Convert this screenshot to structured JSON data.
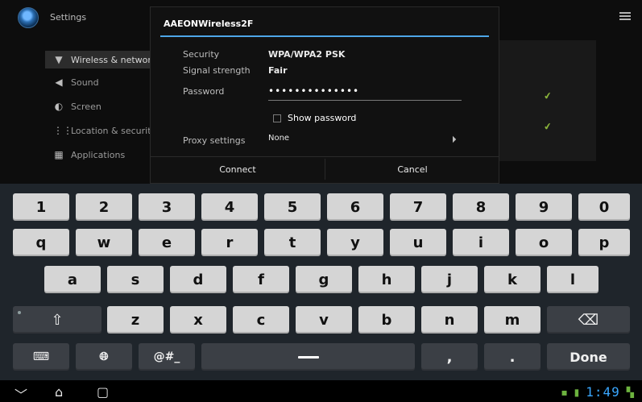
{
  "app": {
    "title": "Settings"
  },
  "settings_menu": {
    "items": [
      {
        "label": "Wireless & networks",
        "icon": "wifi-icon",
        "selected": true
      },
      {
        "label": "Sound",
        "icon": "speaker-icon",
        "selected": false
      },
      {
        "label": "Screen",
        "icon": "screen-icon",
        "selected": false
      },
      {
        "label": "Location & security",
        "icon": "grid-icon",
        "selected": false
      },
      {
        "label": "Applications",
        "icon": "apps-icon",
        "selected": false
      }
    ]
  },
  "dialog": {
    "title": "AAEONWireless2F",
    "security_label": "Security",
    "security_value": "WPA/WPA2 PSK",
    "signal_label": "Signal strength",
    "signal_value": "Fair",
    "password_label": "Password",
    "password_value": "••••••••••••••",
    "show_password_label": "Show password",
    "proxy_label": "Proxy settings",
    "proxy_value": "None",
    "connect_label": "Connect",
    "cancel_label": "Cancel"
  },
  "keyboard": {
    "row1": [
      "1",
      "2",
      "3",
      "4",
      "5",
      "6",
      "7",
      "8",
      "9",
      "0"
    ],
    "row2": [
      "q",
      "w",
      "e",
      "r",
      "t",
      "y",
      "u",
      "i",
      "o",
      "p"
    ],
    "row3": [
      "a",
      "s",
      "d",
      "f",
      "g",
      "h",
      "j",
      "k",
      "l"
    ],
    "row4": [
      "z",
      "x",
      "c",
      "v",
      "b",
      "n",
      "m"
    ],
    "shift_symbol": "⇧",
    "backspace_symbol": "⌫",
    "symbols_label": "@#_",
    "comma_label": ",",
    "period_label": ".",
    "done_label": "Done",
    "keyboard_icon": "keyboard-icon",
    "globe_icon": "globe-icon"
  },
  "status": {
    "time": "1:49"
  }
}
